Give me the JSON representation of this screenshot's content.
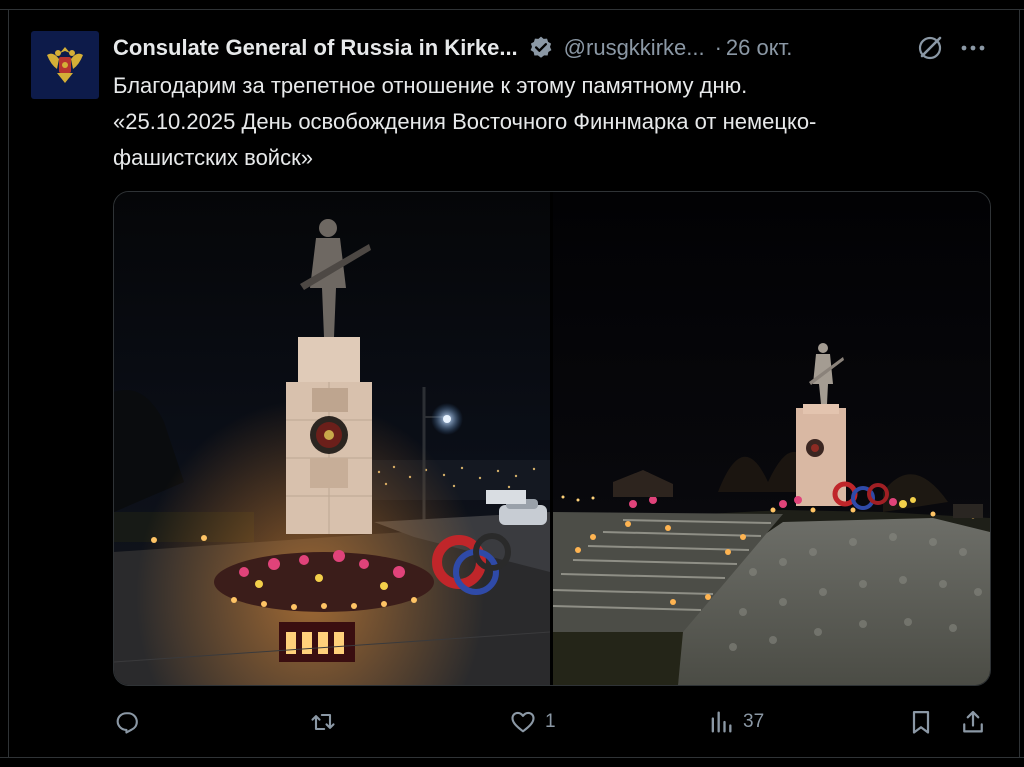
{
  "tweet": {
    "author_name": "Consulate General of Russia in Kirke...",
    "handle": "@rusgkkirke...",
    "separator": "·",
    "date": "26 окт.",
    "text_lines": [
      "Благодарим за трепетное отношение к этому памятному дню.",
      "«25.10.2025 День освобождения Восточного Финнмарка от немецко-",
      "фашистских войск»"
    ]
  },
  "icons": {
    "verified": "verified-badge-icon",
    "grok": "grok-icon",
    "more": "more-icon",
    "reply": "reply-icon",
    "retweet": "retweet-icon",
    "like": "heart-icon",
    "views": "views-icon",
    "bookmark": "bookmark-icon",
    "share": "share-icon"
  },
  "actions": {
    "reply_count": "",
    "retweet_count": "",
    "like_count": "1",
    "views_count": "37"
  },
  "colors": {
    "background": "#000000",
    "text": "#e7e9ea",
    "secondary": "#8b98a5",
    "border": "#2f3336",
    "verified": "#8b98a5"
  }
}
